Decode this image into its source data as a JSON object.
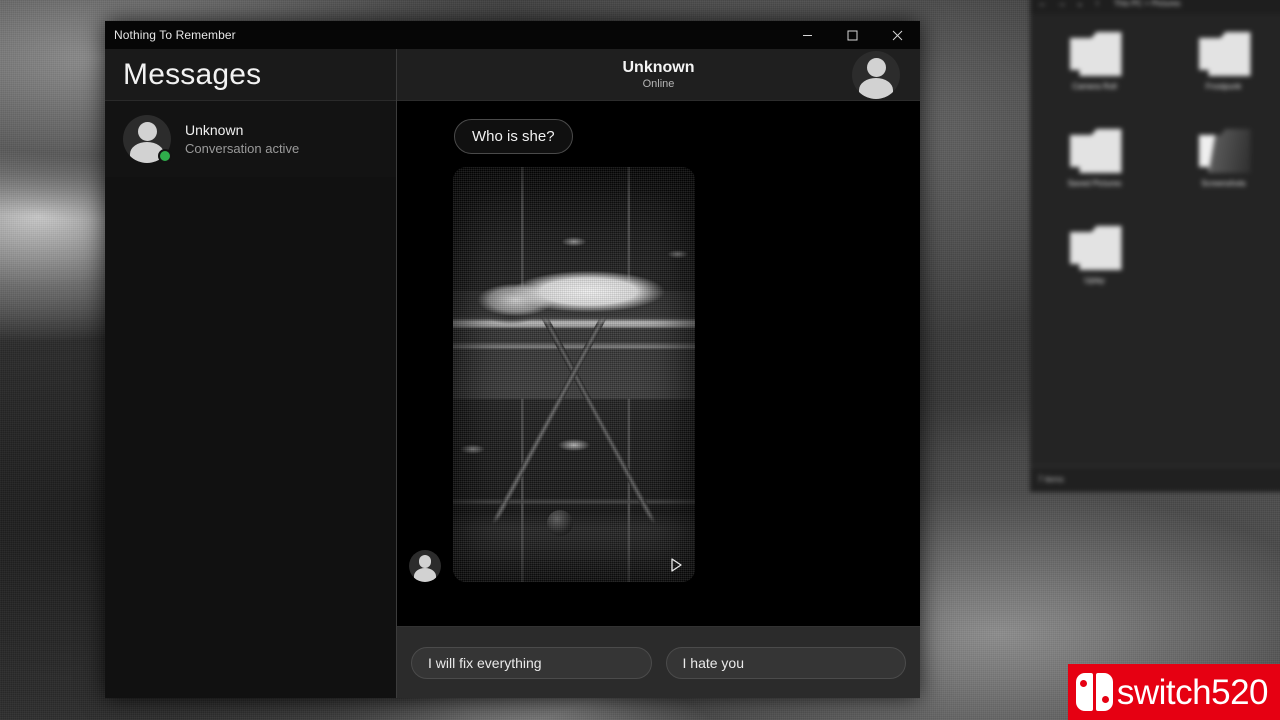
{
  "window": {
    "title": "Nothing To Remember",
    "controls": [
      {
        "name": "minimize",
        "glyph": "minimize-icon"
      },
      {
        "name": "maximize",
        "glyph": "maximize-icon"
      },
      {
        "name": "close",
        "glyph": "close-icon"
      }
    ]
  },
  "sidebar": {
    "heading": "Messages",
    "conversations": [
      {
        "name": "Unknown",
        "subtitle": "Conversation active",
        "avatar_icon": "person-avatar-icon",
        "status": "online",
        "status_color": "#2fae4b"
      }
    ]
  },
  "chat": {
    "header": {
      "name": "Unknown",
      "status": "Online",
      "avatar_icon": "person-avatar-icon"
    },
    "messages": [
      {
        "type": "text",
        "from": "them",
        "text": "Who is she?"
      },
      {
        "type": "media",
        "from": "them",
        "avatar_icon": "person-avatar-icon",
        "media_kind": "video",
        "play_icon": "play-triangle-icon",
        "description": "Black and white photo of a covered body on a morgue gurney"
      }
    ]
  },
  "reply_options": [
    {
      "label": "I will fix everything"
    },
    {
      "label": "I hate you"
    }
  ],
  "explorer": {
    "breadcrumb": "This PC  >  Pictures",
    "nav_icons": [
      "back-icon",
      "forward-icon",
      "recent-icon",
      "up-icon"
    ],
    "folders": [
      {
        "label": "Camera Roll",
        "icon": "folder-icon"
      },
      {
        "label": "Frostpunk",
        "icon": "folder-icon"
      },
      {
        "label": "Saved Pictures",
        "icon": "folder-icon"
      },
      {
        "label": "Screenshots",
        "icon": "folder-open-icon"
      },
      {
        "label": "Uplay",
        "icon": "folder-icon"
      }
    ],
    "status": "7 items"
  },
  "watermark": {
    "text": "switch520",
    "logo_icon": "nintendo-switch-logo-icon",
    "brand_color": "#e60012"
  }
}
